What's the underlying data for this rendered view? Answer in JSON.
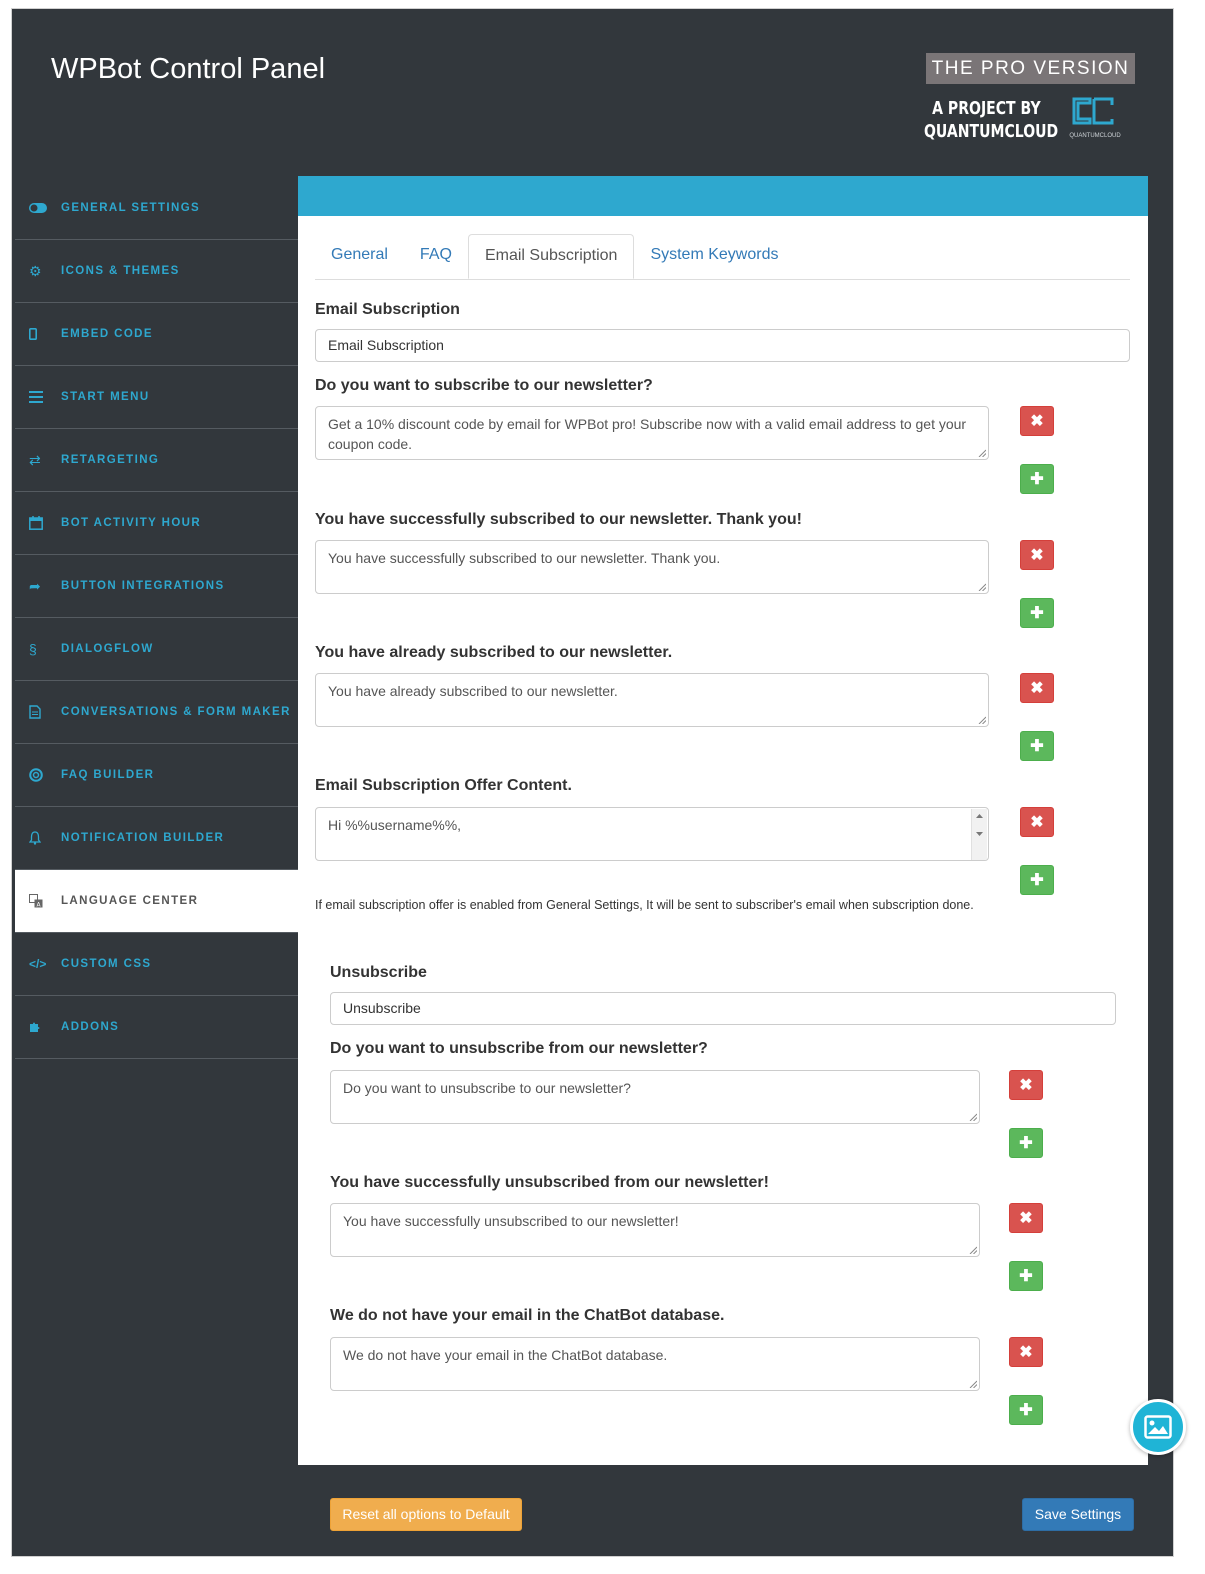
{
  "header": {
    "title": "WPBot Control Panel",
    "pro_badge": "THE PRO VERSION",
    "project_by_line1": "A PROJECT BY",
    "project_by_line2": "QUANTUMCLOUD",
    "logo_small_text": "QUANTUMCLOUD"
  },
  "sidebar": {
    "items": [
      {
        "label": "GENERAL SETTINGS",
        "icon": "toggle-icon"
      },
      {
        "label": "ICONS & THEMES",
        "icon": "gear-icon"
      },
      {
        "label": "EMBED CODE",
        "icon": "mobile-icon"
      },
      {
        "label": "START MENU",
        "icon": "menu-icon"
      },
      {
        "label": "RETARGETING",
        "icon": "retweet-icon"
      },
      {
        "label": "BOT ACTIVITY HOUR",
        "icon": "calendar-icon"
      },
      {
        "label": "BUTTON INTEGRATIONS",
        "icon": "share-icon"
      },
      {
        "label": "DIALOGFLOW",
        "icon": "fingerprint-icon"
      },
      {
        "label": "CONVERSATIONS & FORM MAKER",
        "icon": "document-icon"
      },
      {
        "label": "FAQ BUILDER",
        "icon": "lifebuoy-icon"
      },
      {
        "label": "NOTIFICATION BUILDER",
        "icon": "bell-icon"
      },
      {
        "label": "LANGUAGE CENTER",
        "icon": "language-icon",
        "active": true
      },
      {
        "label": "CUSTOM CSS",
        "icon": "code-icon"
      },
      {
        "label": "ADDONS",
        "icon": "puzzle-icon"
      }
    ]
  },
  "tabs": [
    "General",
    "FAQ",
    "Email Subscription",
    "System Keywords"
  ],
  "active_tab": "Email Subscription",
  "email_subscription": {
    "title_label": "Email Subscription",
    "title_value": "Email Subscription",
    "q1_label": "Do you want to subscribe to our newsletter?",
    "q1_value": "Get a 10% discount code by email for WPBot pro! Subscribe now with a valid email address to get your coupon code.",
    "q2_label": "You have successfully subscribed to our newsletter. Thank you!",
    "q2_value": "You have successfully subscribed to our newsletter. Thank you.",
    "q3_label": "You have already subscribed to our newsletter.",
    "q3_value": "You have already subscribed to our newsletter.",
    "q4_label": "Email Subscription Offer Content.",
    "q4_value": "Hi %%username%%,",
    "note": "If email subscription offer is enabled from General Settings, It will be sent to subscriber's email when subscription done."
  },
  "unsubscribe": {
    "title_label": "Unsubscribe",
    "title_value": "Unsubscribe",
    "q1_label": "Do you want to unsubscribe from our newsletter?",
    "q1_value": "Do you want to unsubscribe to our newsletter?",
    "q2_label": "You have successfully unsubscribed from our newsletter!",
    "q2_value": "You have successfully unsubscribed to our newsletter!",
    "q3_label": "We do not have your email in the ChatBot database.",
    "q3_value": "We do not have your email in the ChatBot database."
  },
  "footer": {
    "reset_label": "Reset all options to Default",
    "save_label": "Save Settings"
  },
  "colors": {
    "panel_bg": "#32373c",
    "accent": "#2ea8cf",
    "danger": "#d9534f",
    "success": "#5cb85c",
    "warning": "#f0ad4e",
    "primary": "#337ab7"
  }
}
